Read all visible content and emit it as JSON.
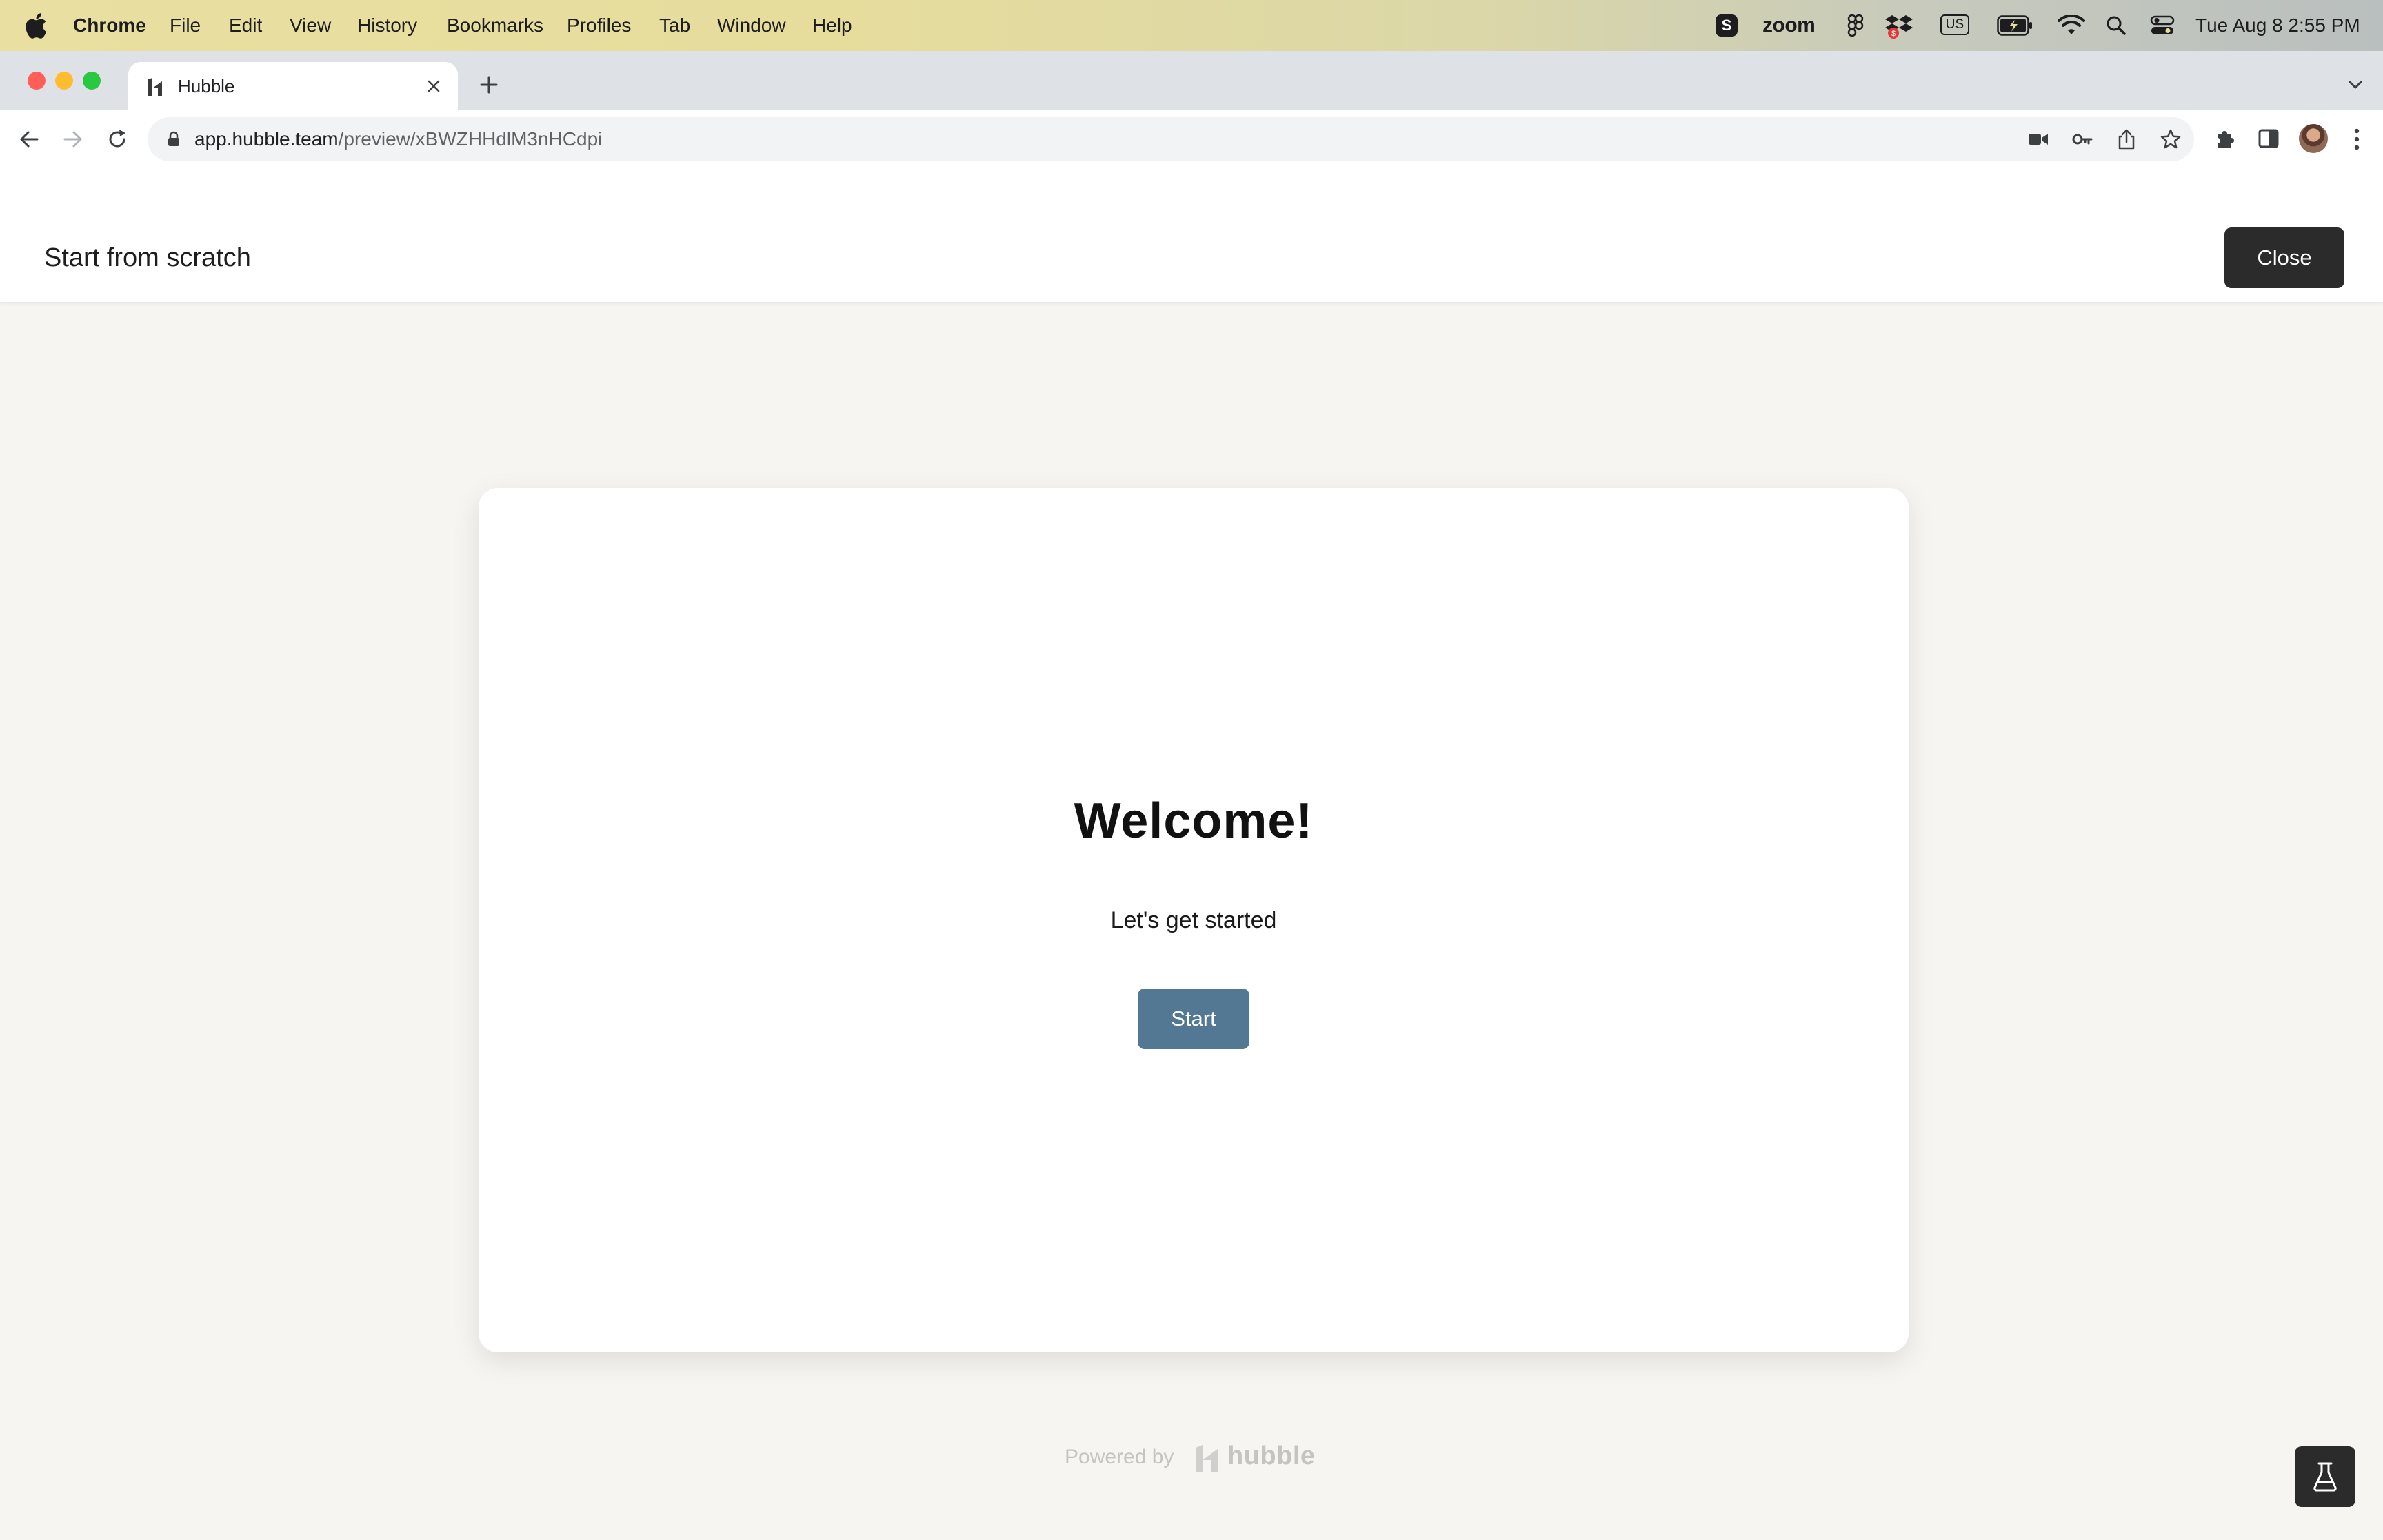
{
  "os_menu_bar": {
    "app_name": "Chrome",
    "menus": [
      "File",
      "Edit",
      "View",
      "History",
      "Bookmarks",
      "Profiles",
      "Tab",
      "Window",
      "Help"
    ],
    "status": {
      "zoom_label": "zoom",
      "keyboard_label": "US",
      "datetime": "Tue Aug 8  2:55 PM"
    }
  },
  "browser": {
    "tab_title": "Hubble",
    "url_host": "app.hubble.team",
    "url_path": "/preview/xBWZHHdlM3nHCdpi"
  },
  "app_header": {
    "title": "Start from scratch",
    "close_label": "Close"
  },
  "card": {
    "heading": "Welcome!",
    "subtitle": "Let's get started",
    "start_label": "Start"
  },
  "footer": {
    "powered_by": "Powered by",
    "brand": "hubble"
  },
  "colors": {
    "start_button": "#527893",
    "close_button": "#2b2b2b",
    "page_background": "#f6f5f1"
  }
}
